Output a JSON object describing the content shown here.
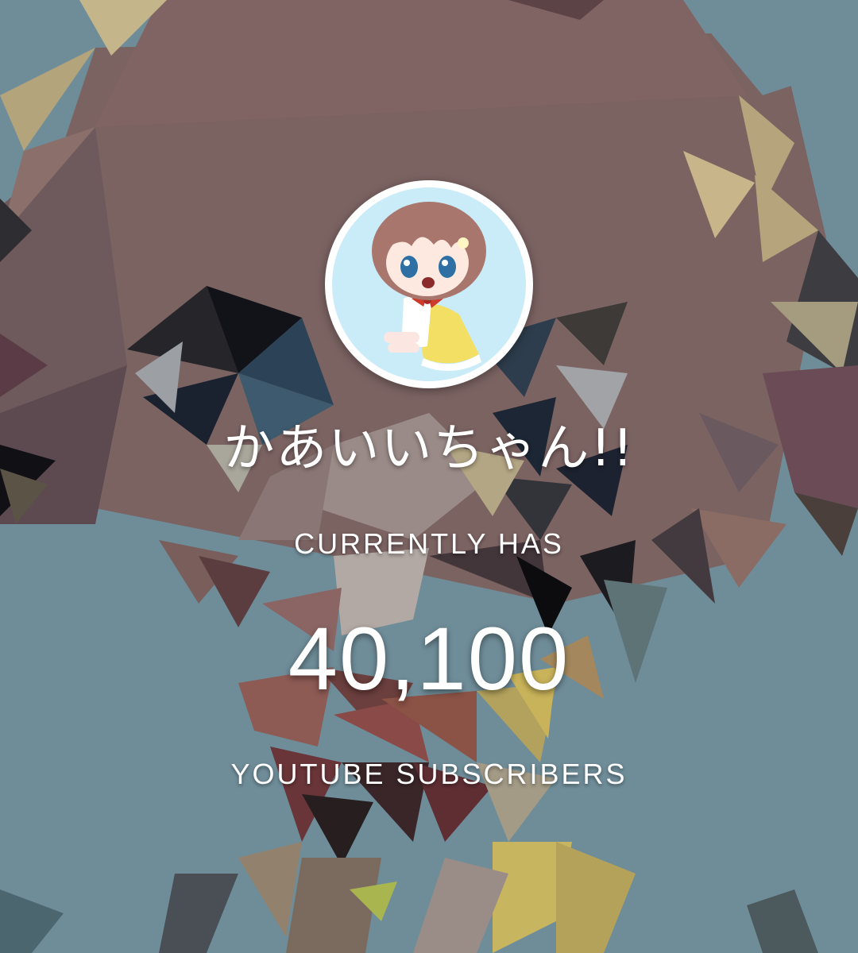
{
  "channel": {
    "name": "かあいいちゃん!!",
    "avatar_icon": "chibi-character-avatar-icon"
  },
  "stats": {
    "prefix_label": "CURRENTLY HAS",
    "subscriber_count": "40,100",
    "suffix_label": "YOUTUBE SUBSCRIBERS"
  },
  "colors": {
    "background_base": "#6f8d99",
    "text": "#ffffff",
    "avatar_bg": "#c9ecf8"
  }
}
